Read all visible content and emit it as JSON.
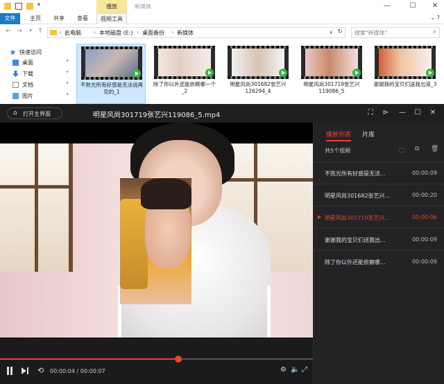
{
  "explorer": {
    "context_tab": "播放",
    "title": "新媒体",
    "ribbon_tabs": [
      "文件",
      "主页",
      "共享",
      "查看",
      "视频工具"
    ],
    "breadcrumb": [
      "此电脑",
      "本地磁盘 (E:)",
      "桌面备份",
      "新媒体"
    ],
    "search_placeholder": "搜索\"新媒体\"",
    "nav_items": [
      {
        "label": "快速访问",
        "icon": "star-icon"
      },
      {
        "label": "桌面",
        "icon": "desktop-icon"
      },
      {
        "label": "下载",
        "icon": "download-icon"
      },
      {
        "label": "文档",
        "icon": "document-icon"
      },
      {
        "label": "图片",
        "icon": "pictures-icon"
      }
    ],
    "files": [
      {
        "name": "不败光所有好感是无法说再见的_1",
        "selected": true
      },
      {
        "name": "除了你以外还能依赖哪一个_2",
        "selected": false
      },
      {
        "name": "明星风尚301682张艺兴126294_4",
        "selected": false
      },
      {
        "name": "明星风尚301719张艺兴119086_5",
        "selected": false
      },
      {
        "name": "谢谢我的宝贝们送我出道_3",
        "selected": false
      }
    ]
  },
  "player": {
    "home_button": "打开主界面",
    "title": "明星风尚301719张艺兴119086_5.mp4",
    "progress": 0.57,
    "time_current": "00:00:04",
    "time_total": "00:00:07",
    "playlist": {
      "tabs": [
        "播放列表",
        "片库"
      ],
      "count_label": "共5个视频",
      "items": [
        {
          "name": "不败光所有好感是无法...",
          "duration": "00:00:09",
          "playing": false
        },
        {
          "name": "明星风尚301682张艺兴...",
          "duration": "00:00:20",
          "playing": false
        },
        {
          "name": "明星风尚301719张艺兴...",
          "duration": "00:00:06",
          "playing": true
        },
        {
          "name": "谢谢我的宝贝们送我出...",
          "duration": "00:00:09",
          "playing": false
        },
        {
          "name": "除了你以外还能依赖哪...",
          "duration": "00:00:09",
          "playing": false
        }
      ]
    }
  },
  "colors": {
    "accent": "#e8452f",
    "selection": "#cce8ff",
    "file_tab": "#1979ca"
  }
}
